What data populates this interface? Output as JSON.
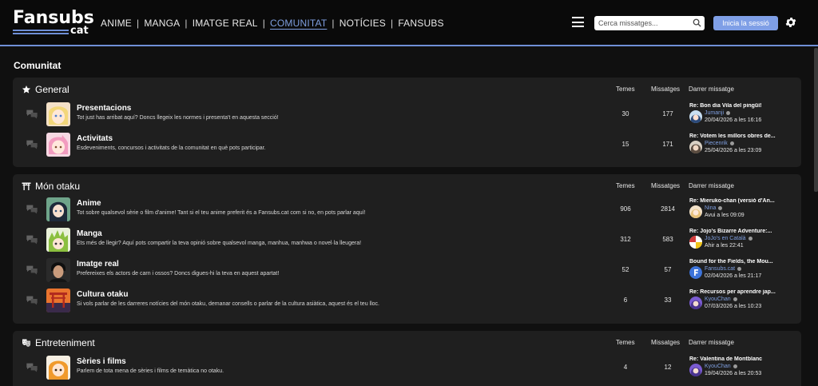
{
  "logo": {
    "main": "Fansubs",
    "sub": "cat"
  },
  "nav": [
    {
      "label": "ANIME",
      "active": false
    },
    {
      "label": "MANGA",
      "active": false
    },
    {
      "label": "IMATGE REAL",
      "active": false
    },
    {
      "label": "COMUNITAT",
      "active": true
    },
    {
      "label": "NOTÍCIES",
      "active": false
    },
    {
      "label": "FANSUBS",
      "active": false
    }
  ],
  "nav_separator": "|",
  "search": {
    "placeholder": "Cerca missatges...",
    "icon": "search-icon"
  },
  "login_label": "Inicia la sessió",
  "colors": {
    "accent": "#7f9fe6",
    "background": "#101010",
    "card": "#1f1f1f",
    "link": "#7f9fe0"
  },
  "page_title": "Comunitat",
  "columns": {
    "temes": "Temes",
    "missatges": "Missatges",
    "last": "Darrer missatge"
  },
  "categories": [
    {
      "title": "General",
      "icon": "star-icon",
      "forums": [
        {
          "name": "Presentacions",
          "desc": "Tot just has arribat aquí? Doncs llegeix les normes i presenta't en aquesta secció!",
          "temes": "30",
          "missatges": "177",
          "last_title": "Re: Bon dia Vila del pingüí!",
          "last_user": "Jumanji",
          "last_date": "20/04/2026 a les 16:16"
        },
        {
          "name": "Activitats",
          "desc": "Esdeveniments, concursos i activitats de la comunitat en què pots participar.",
          "temes": "15",
          "missatges": "171",
          "last_title": "Re: Votem les millors obres de...",
          "last_user": "Piecenrik",
          "last_date": "25/04/2026 a les 23:09"
        }
      ]
    },
    {
      "title": "Món otaku",
      "icon": "torii-icon",
      "forums": [
        {
          "name": "Anime",
          "desc": "Tot sobre qualsevol sèrie o film d'anime! Tant si el teu anime preferit és a Fansubs.cat com si no, en pots parlar aquí!",
          "temes": "906",
          "missatges": "2814",
          "last_title": "Re: Mieruko-chan (versió d'An...",
          "last_user": "Nina",
          "last_date": "Avui a les 09:09"
        },
        {
          "name": "Manga",
          "desc": "Ets més de llegir? Aquí pots compartir la teva opinió sobre qualsevol manga, manhua, manhwa o novel·la lleugera!",
          "temes": "312",
          "missatges": "583",
          "last_title": "Re: Jojo's Bizarre Adventure:...",
          "last_user": "JoJo's en Català",
          "last_date": "Ahir a les 22:41"
        },
        {
          "name": "Imatge real",
          "desc": "Prefereixes els actors de carn i ossos? Doncs digues-hi la teva en aquest apartat!",
          "temes": "52",
          "missatges": "57",
          "last_title": "Bound for the Fields, the Mou...",
          "last_user": "Fansubs.cat",
          "last_date": "02/04/2026 a les 21:17"
        },
        {
          "name": "Cultura otaku",
          "desc": "Si vols parlar de les darreres notícies del món otaku, demanar consells o parlar de la cultura asiàtica, aquest és el teu lloc.",
          "temes": "6",
          "missatges": "33",
          "last_title": "Re: Recursos per aprendre jap...",
          "last_user": "KyouChan",
          "last_date": "07/03/2026 a les 10:23"
        }
      ]
    },
    {
      "title": "Entreteniment",
      "icon": "theater-masks-icon",
      "forums": [
        {
          "name": "Sèries i films",
          "desc": "Parlem de tota mena de sèries i films de temàtica no otaku.",
          "temes": "4",
          "missatges": "12",
          "last_title": "Re: Valentina de Montblanc",
          "last_user": "KyouChan",
          "last_date": "19/04/2026 a les 20:53"
        }
      ]
    }
  ]
}
